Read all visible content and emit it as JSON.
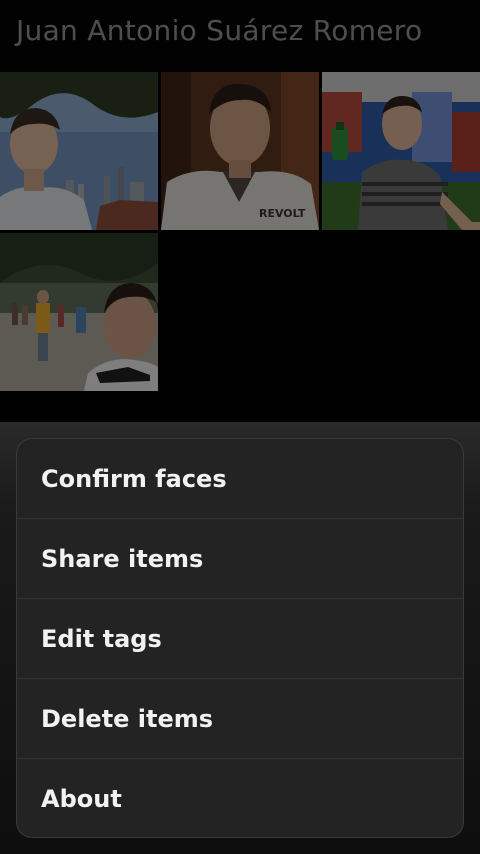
{
  "header": {
    "title": "Juan Antonio Suárez Romero"
  },
  "gallery": {
    "items": [
      {
        "name": "photo-1",
        "description_icon": "face-photo"
      },
      {
        "name": "photo-2",
        "description_icon": "face-photo"
      },
      {
        "name": "photo-3",
        "description_icon": "face-photo"
      },
      {
        "name": "photo-4",
        "description_icon": "face-photo"
      }
    ]
  },
  "menu": {
    "items": [
      {
        "label": "Confirm faces"
      },
      {
        "label": "Share items"
      },
      {
        "label": "Edit tags"
      },
      {
        "label": "Delete items"
      },
      {
        "label": "About"
      }
    ]
  },
  "colors": {
    "background": "#000000",
    "title_text": "#8f8f8f",
    "menu_background": "#232323",
    "menu_text": "#f2f2f2"
  }
}
